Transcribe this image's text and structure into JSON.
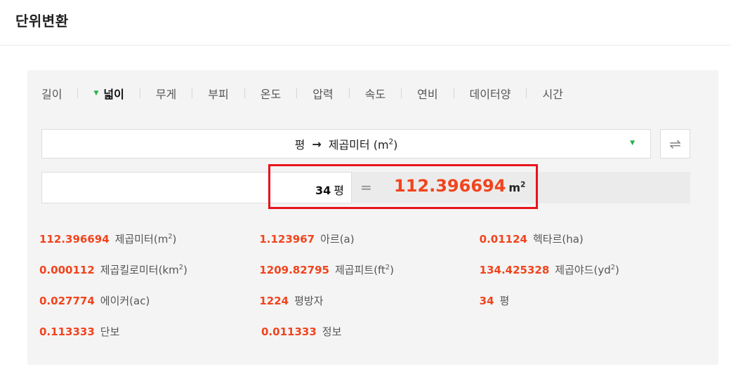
{
  "title": "단위변환",
  "tabs": [
    {
      "label": "길이",
      "active": false
    },
    {
      "label": "넓이",
      "active": true
    },
    {
      "label": "무게",
      "active": false
    },
    {
      "label": "부피",
      "active": false
    },
    {
      "label": "온도",
      "active": false
    },
    {
      "label": "압력",
      "active": false
    },
    {
      "label": "속도",
      "active": false
    },
    {
      "label": "연비",
      "active": false
    },
    {
      "label": "데이터양",
      "active": false
    },
    {
      "label": "시간",
      "active": false
    }
  ],
  "selector": {
    "from": "평",
    "arrow": "→",
    "to_base": "제곱미터 (m",
    "to_sup": "2",
    "to_close": ")"
  },
  "input": {
    "value": "34",
    "unit": "평",
    "equals": "="
  },
  "result": {
    "value": "112.396694",
    "unit_base": "m",
    "unit_sup": "2"
  },
  "conversions": [
    [
      {
        "value": "112.396694",
        "label": "제곱미터(m",
        "sup": "2",
        "close": ")"
      },
      {
        "value": "1.123967",
        "label": "아르(a)",
        "sup": "",
        "close": ""
      },
      {
        "value": "0.01124",
        "label": "헥타르(ha)",
        "sup": "",
        "close": ""
      }
    ],
    [
      {
        "value": "0.000112",
        "label": "제곱킬로미터(km",
        "sup": "2",
        "close": ")"
      },
      {
        "value": "1209.82795",
        "label": "제곱피트(ft",
        "sup": "2",
        "close": ")"
      },
      {
        "value": "134.425328",
        "label": "제곱야드(yd",
        "sup": "2",
        "close": ")"
      }
    ],
    [
      {
        "value": "0.027774",
        "label": "에이커(ac)",
        "sup": "",
        "close": ""
      },
      {
        "value": "1224",
        "label": "평방자",
        "sup": "",
        "close": ""
      },
      {
        "value": "34",
        "label": "평",
        "sup": "",
        "close": ""
      }
    ],
    [
      {
        "value": "0.113333",
        "label": "단보",
        "sup": "",
        "close": ""
      },
      {
        "value": "0.011333",
        "label": "정보",
        "sup": "",
        "close": ""
      }
    ]
  ],
  "colors": {
    "accent": "#f0441e",
    "highlight": "#e8131b",
    "tab_marker": "#27b04a"
  }
}
